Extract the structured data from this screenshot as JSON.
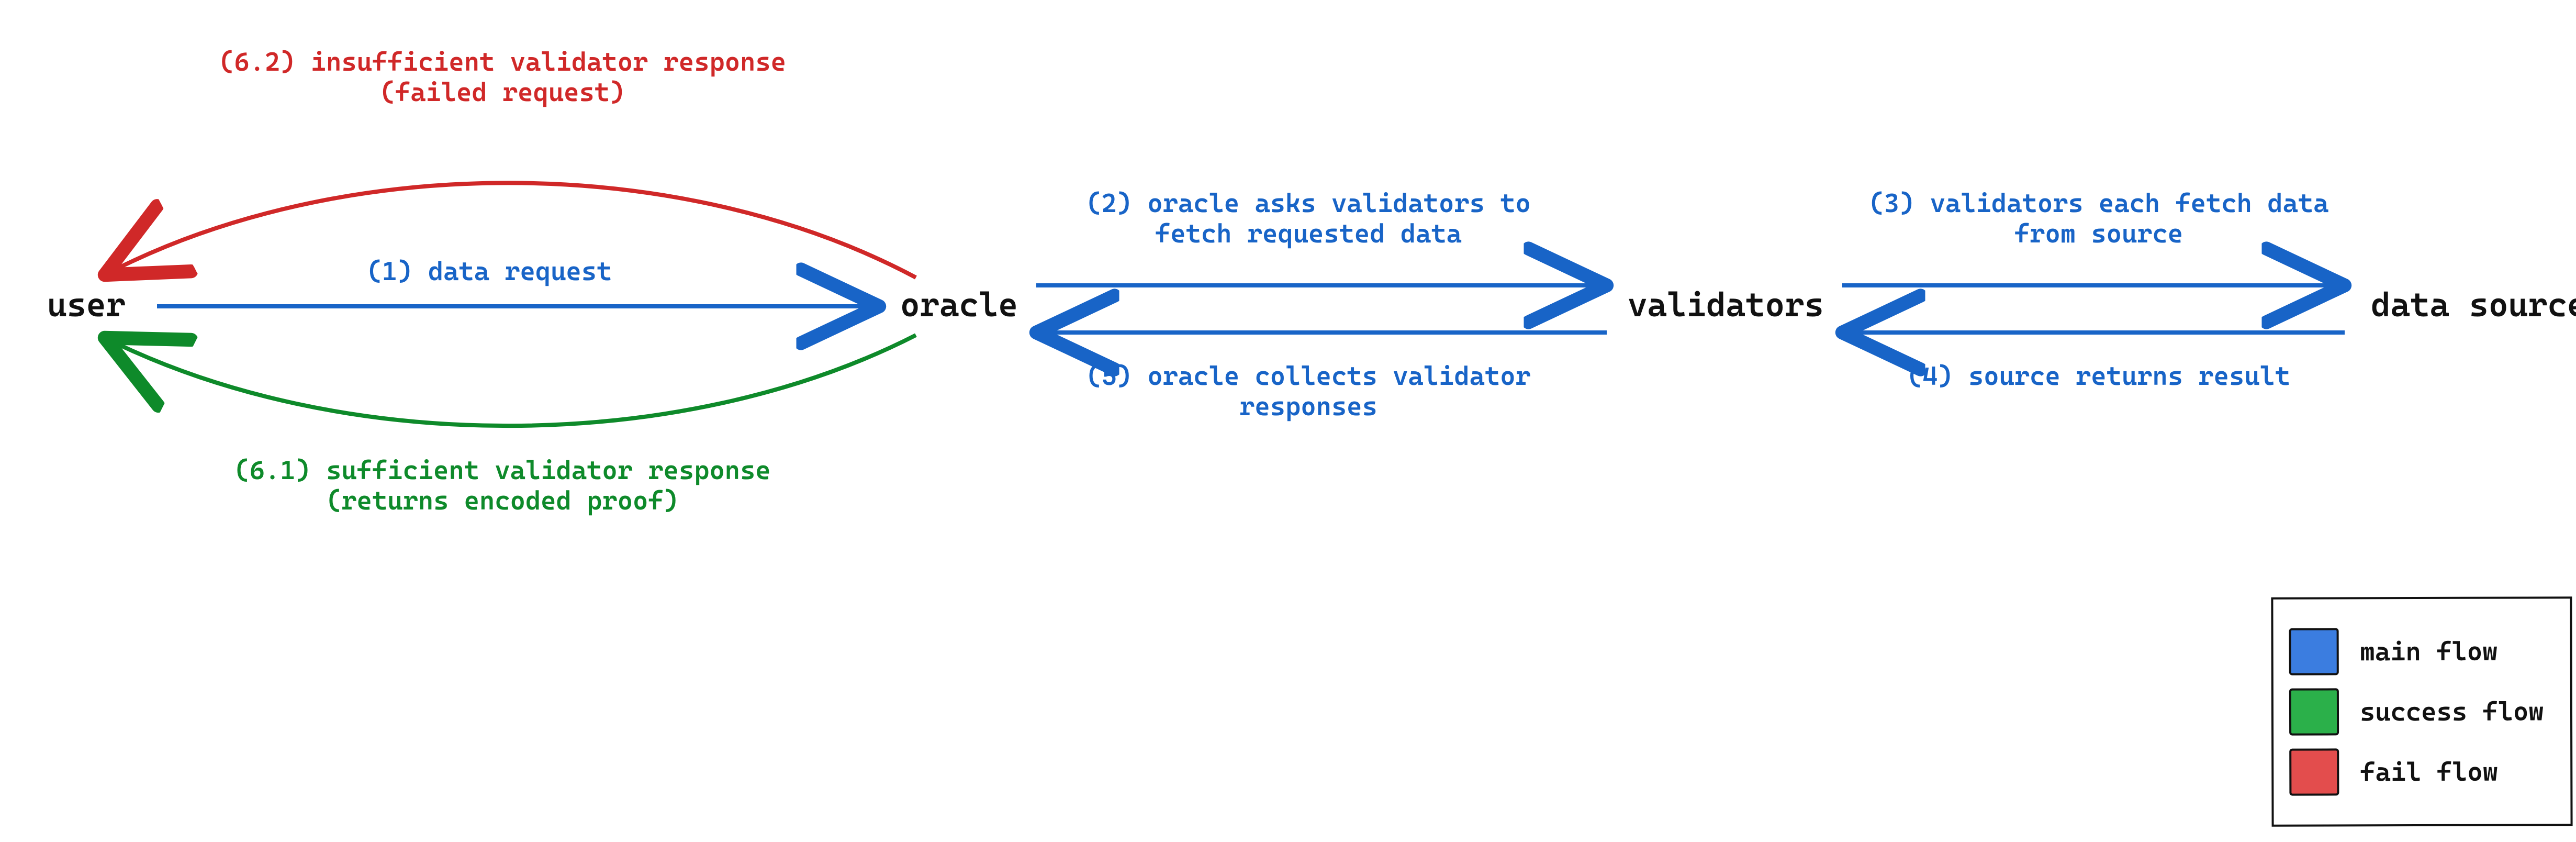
{
  "nodes": {
    "user": "user",
    "oracle": "oracle",
    "validators": "validators",
    "data_source": "data source"
  },
  "edges": {
    "step1": "(1) data request",
    "step2": "(2) oracle asks validators to\nfetch requested data",
    "step3": "(3) validators each fetch data\nfrom source",
    "step4": "(4) source returns result",
    "step5": "(5) oracle collects validator\nresponses",
    "step6_1": "(6.1) sufficient validator response\n(returns encoded proof)",
    "step6_2": "(6.2) insufficient validator response\n(failed request)"
  },
  "legend": {
    "main": "main flow",
    "success": "success flow",
    "fail": "fail flow"
  },
  "colors": {
    "main": "#1864c7",
    "success": "#0e8a2a",
    "fail": "#d02828",
    "ink": "#111111",
    "swatch_blue": "#3b7de0",
    "swatch_green": "#2bb04a",
    "swatch_red": "#e34d4d"
  }
}
